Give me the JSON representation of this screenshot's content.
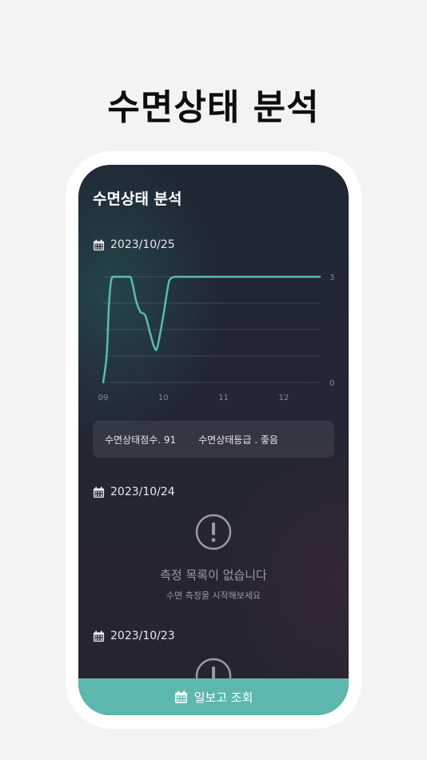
{
  "hero": {
    "title": "수면상태 분석"
  },
  "screen": {
    "title": "수면상태 분석",
    "sections": [
      {
        "date": "2023/10/25",
        "score_label": "수면상태점수. 91",
        "grade_label": "수면상태등급 . 좋음"
      },
      {
        "date": "2023/10/24",
        "empty_title": "측정 목록이 없습니다",
        "empty_sub": "수면 측정을 시작해보세요"
      },
      {
        "date": "2023/10/23"
      }
    ]
  },
  "chart_data": {
    "type": "line",
    "x_tick_labels": [
      "09",
      "10",
      "11",
      "12"
    ],
    "y_tick_labels": [
      "3",
      "0"
    ],
    "ylim": [
      0,
      3
    ],
    "xlim": [
      9.0,
      12.6
    ],
    "grid": true,
    "series": [
      {
        "color": "#5cbcae",
        "x": [
          9.0,
          9.06,
          9.1,
          9.15,
          9.25,
          9.35,
          9.45,
          9.5,
          9.55,
          9.62,
          9.7,
          9.78,
          9.85,
          9.9,
          10.0,
          10.1,
          10.2,
          10.35,
          10.6,
          11.0,
          11.5,
          12.0,
          12.6
        ],
        "values": [
          0,
          0.8,
          2.3,
          3,
          3,
          3,
          3,
          2.7,
          2.3,
          2.0,
          1.9,
          1.4,
          1.0,
          1.0,
          1.9,
          2.9,
          3,
          3,
          3,
          3,
          3,
          3,
          3
        ]
      }
    ],
    "line_color": "#5cbcae"
  },
  "bottom_bar": {
    "label": "일보고 조회"
  },
  "colors": {
    "accent": "#5cb8ac",
    "background": "#f3f3f3"
  }
}
